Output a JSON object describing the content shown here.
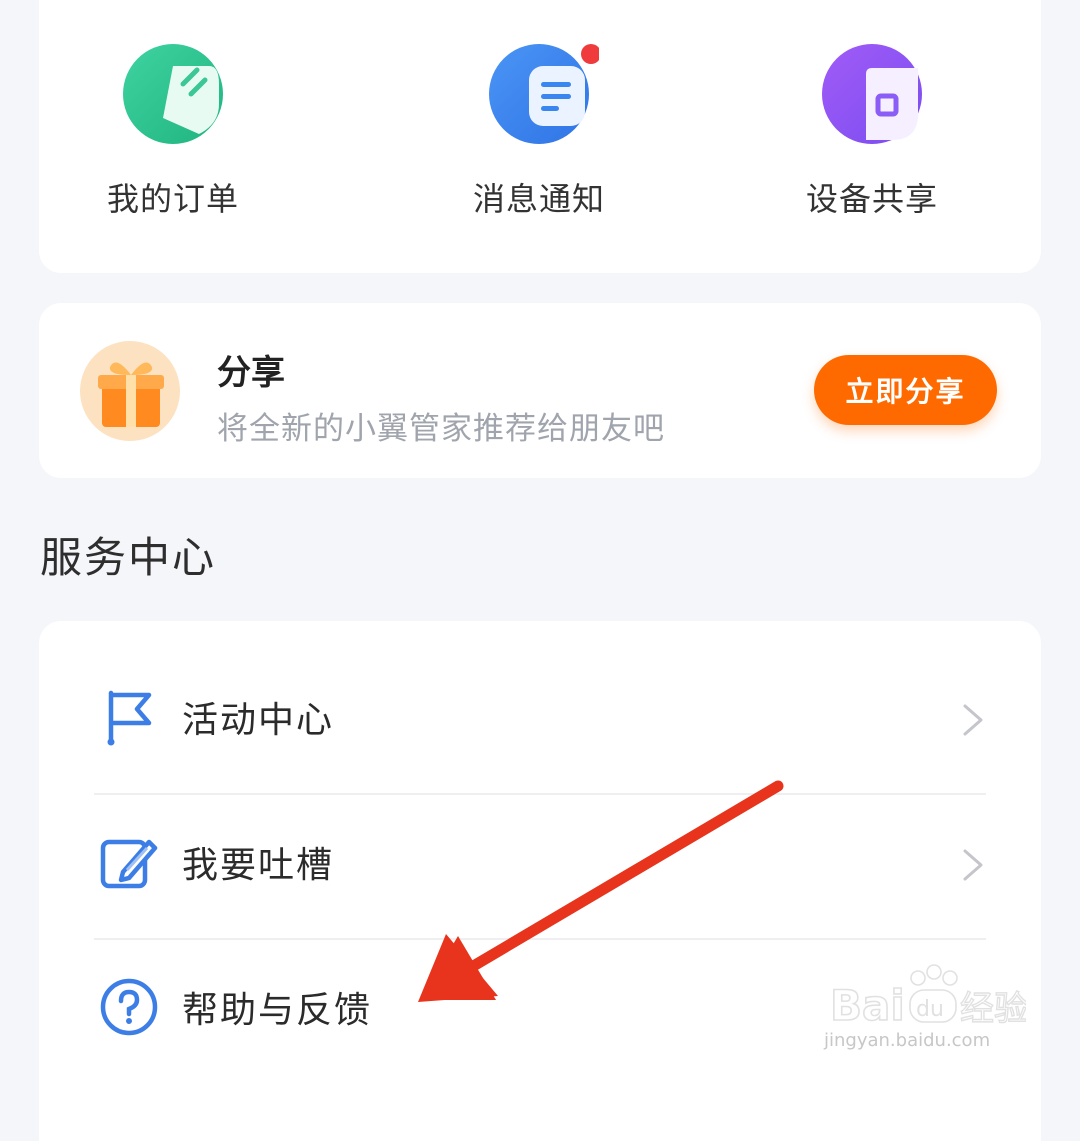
{
  "quick_actions": [
    {
      "label": "我的订单",
      "icon": "order-icon",
      "color": "#27c48e"
    },
    {
      "label": "消息通知",
      "icon": "message-icon",
      "color": "#3a86f0",
      "badge": true
    },
    {
      "label": "设备共享",
      "icon": "device-share-icon",
      "color": "#8b5cf6"
    }
  ],
  "share": {
    "title": "分享",
    "description": "将全新的小翼管家推荐给朋友吧",
    "button": "立即分享",
    "icon": "gift-icon"
  },
  "service_center": {
    "heading": "服务中心",
    "items": [
      {
        "label": "活动中心",
        "icon": "flag-icon"
      },
      {
        "label": "我要吐槽",
        "icon": "edit-icon"
      },
      {
        "label": "帮助与反馈",
        "icon": "help-icon"
      }
    ]
  },
  "watermark": {
    "brand": "Bai du 经验",
    "url": "jingyan.baidu.com"
  },
  "colors": {
    "accent_orange": "#ff6a00",
    "icon_blue": "#3d7ee6",
    "arrow_red": "#e8341c"
  }
}
